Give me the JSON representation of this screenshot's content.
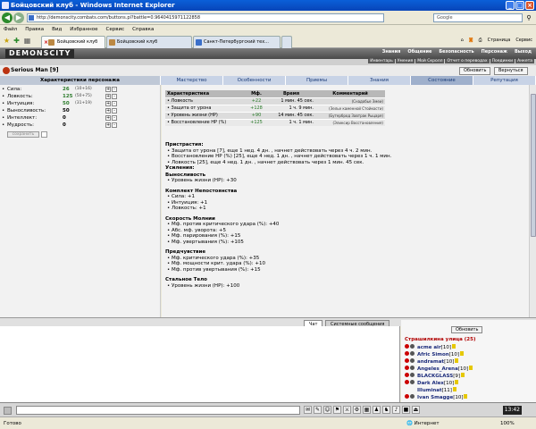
{
  "window": {
    "title": "Бойцовский клуб - Windows Internet Explorer"
  },
  "address": {
    "url": "http://demonscity.combats.com/buttons.pl?battle=0.9640415971122858",
    "search_placeholder": "Google"
  },
  "menu": [
    "Файл",
    "Правка",
    "Вид",
    "Избранное",
    "Сервис",
    "Справка"
  ],
  "tabs": [
    {
      "label": "Бойцовский клуб",
      "active": true
    },
    {
      "label": "Бойцовский клуб",
      "active": false
    },
    {
      "label": "Санкт-Петербургский тех...",
      "active": false
    }
  ],
  "toolbar_right": {
    "page": "Страница",
    "tools": "Сервис"
  },
  "game": {
    "logo": "DEMONSCITY",
    "top_menu": [
      "Знания",
      "Общение",
      "Безопасность",
      "Персонаж",
      "Выход"
    ],
    "sub_menu": [
      "Инвентарь",
      "Умения",
      "Мой Скролл",
      "Отчет о переводах",
      "Поединки",
      "Анкета"
    ]
  },
  "character": {
    "name": "Serious Man",
    "level": "[9]",
    "refresh_label": "Обновить",
    "return_label": "Вернуться"
  },
  "section_tabs": {
    "left": "Характеристики персонажа",
    "items": [
      "Мастерство",
      "Особенности",
      "Приемы",
      "Знания",
      "Состояние",
      "Репутация"
    ],
    "active": "Состояние"
  },
  "stats": [
    {
      "label": "Сила:",
      "value": "26",
      "extra": "(10+16)",
      "green": true
    },
    {
      "label": "Ловкость:",
      "value": "125",
      "extra": "(50+75)",
      "green": true
    },
    {
      "label": "Интуиция:",
      "value": "50",
      "extra": "(31+19)",
      "green": true
    },
    {
      "label": "Выносливость:",
      "value": "50",
      "extra": "",
      "green": false
    },
    {
      "label": "Интеллект:",
      "value": "0",
      "extra": "",
      "green": false
    },
    {
      "label": "Мудрость:",
      "value": "0",
      "extra": "",
      "green": false
    }
  ],
  "save_label": "сохранить",
  "effects_table": {
    "headers": [
      "Характеристика",
      "Мф.",
      "Время",
      "Комментарий"
    ],
    "rows": [
      [
        "• Ловкость",
        "+22",
        "1 мин. 45 сек.",
        "(Снадобье Змеи)"
      ],
      [
        "• Защита от урона",
        "+128",
        "1 ч. 9 мин.",
        "(Зелье каменной Стойкости)"
      ],
      [
        "• Уровень жизни (HP)",
        "+90",
        "14 мин. 45 сек.",
        "(Бутерброд Завтрак Рыцаря)"
      ],
      [
        "• Восстановление HP (%)",
        "+125",
        "1 ч. 1 мин.",
        "(Эликсир Восстановления)"
      ]
    ]
  },
  "injuries": {
    "title": "Пристрастия:",
    "items": [
      "• Защита от урона [7], еще 1 нед. 4 дн. , начнет действовать через 4 ч. 2 мин.",
      "• Восстановление HP (%) [25], еще 4 нед. 1 дн. , начнет действовать через 1 ч. 1 мин.",
      "• Ловкость [25], еще 4 нед. 1 дн. , начнет действовать через 1 мин. 45 сек."
    ]
  },
  "boosts": {
    "title": "Усиления:",
    "groups": [
      {
        "name": "Выносливость",
        "items": [
          "• Уровень жизни (HP): +30"
        ]
      },
      {
        "name": "Комплект Непостоянства",
        "items": [
          "• Сила: +1",
          "• Интуиция: +1",
          "• Ловкость: +1"
        ]
      },
      {
        "name": "Скорость Молнии",
        "items": [
          "• Мф. против критического удара (%): +40",
          "• Абс. мф. уворота: +5",
          "• Мф. парирования (%): +15",
          "• Мф. увертывания (%): +105"
        ]
      },
      {
        "name": "Предчувствие",
        "items": [
          "• Мф. критического удара (%): +35",
          "• Мф. мощности крит. удара (%): +10",
          "• Мф. против увертывания (%): +15"
        ]
      },
      {
        "name": "Стальное Тело",
        "items": [
          "• Уровень жизни (HP): +100"
        ]
      }
    ]
  },
  "chat_tabs": [
    "Чат",
    "Системные сообщения"
  ],
  "online": {
    "refresh_label": "Обновить",
    "room": "Страшилкина улица (25)",
    "users": [
      {
        "name": "acme air",
        "level": "[10]"
      },
      {
        "name": "Afric Simon",
        "level": "[10]"
      },
      {
        "name": "andramat",
        "level": "[10]"
      },
      {
        "name": "Angeles_Arena",
        "level": "[10]"
      },
      {
        "name": "BLACKGLASS",
        "level": "[9]"
      },
      {
        "name": "Dark Alex",
        "level": "[10]"
      },
      {
        "name": "Illuminat",
        "level": "[11]"
      },
      {
        "name": "Ivan Smagge",
        "level": "[10]"
      }
    ]
  },
  "clock": "13:42",
  "status": {
    "left": "Готово",
    "net": "Интернет",
    "zoom": "100%"
  }
}
